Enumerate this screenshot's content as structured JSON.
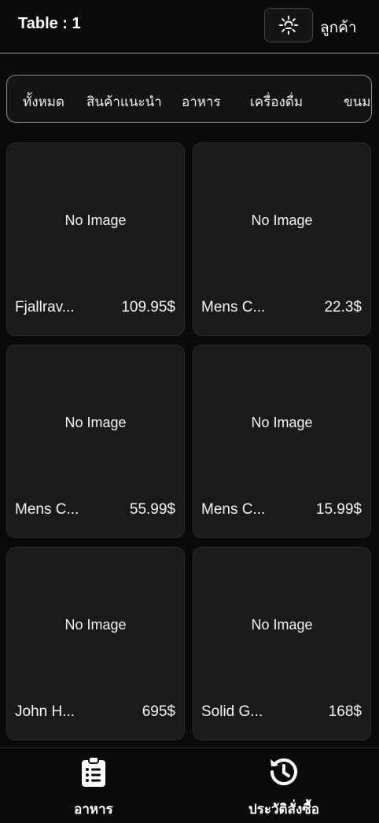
{
  "header": {
    "title": "Table : 1",
    "theme_icon": "sun-icon",
    "customer_label": "ลูกค้า"
  },
  "categories": [
    {
      "label": "ทั้งหมด"
    },
    {
      "label": "สินค้าแนะนำ"
    },
    {
      "label": "อาหาร"
    },
    {
      "label": "เครื่องดื่ม"
    },
    {
      "label": "ขนม"
    }
  ],
  "products": [
    {
      "image_text": "No Image",
      "name": "Fjallrav...",
      "price": "109.95$"
    },
    {
      "image_text": "No Image",
      "name": "Mens C...",
      "price": "22.3$"
    },
    {
      "image_text": "No Image",
      "name": "Mens C...",
      "price": "55.99$"
    },
    {
      "image_text": "No Image",
      "name": "Mens C...",
      "price": "15.99$"
    },
    {
      "image_text": "No Image",
      "name": "John H...",
      "price": "695$"
    },
    {
      "image_text": "No Image",
      "name": "Solid G...",
      "price": "168$"
    }
  ],
  "bottom_nav": {
    "food": {
      "label": "อาหาร",
      "icon": "clipboard-list-icon"
    },
    "history": {
      "label": "ประวัติสั่งซื้อ",
      "icon": "history-icon"
    }
  }
}
